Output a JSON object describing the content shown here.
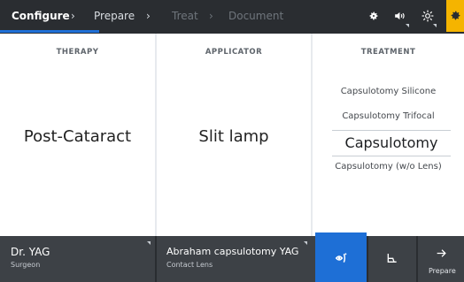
{
  "workflow": {
    "steps": [
      {
        "label": "Configure",
        "state": "active"
      },
      {
        "label": "Prepare",
        "state": "enabled"
      },
      {
        "label": "Treat",
        "state": "disabled"
      },
      {
        "label": "Document",
        "state": "disabled"
      }
    ]
  },
  "toolbar": {
    "icons": [
      "gear-icon",
      "speaker-icon",
      "brightness-icon",
      "settings-icon"
    ],
    "accent_color": "#f5b400"
  },
  "therapy": {
    "heading": "THERAPY",
    "value": "Post-Cataract"
  },
  "applicator": {
    "heading": "APPLICATOR",
    "value": "Slit lamp"
  },
  "treatment": {
    "heading": "TREATMENT",
    "options": [
      "Capsulotomy Silicone",
      "Capsulotomy Trifocal",
      "Capsulotomy",
      "Capsulotomy (w/o Lens)"
    ],
    "selected": "Capsulotomy"
  },
  "bottom": {
    "surgeon_name": "Dr. YAG",
    "surgeon_role": "Surgeon",
    "procedure_name": "Abraham capsulotomy YAG",
    "procedure_lens": "Contact Lens",
    "next_label": "Prepare",
    "active_color": "#1e6fd6"
  }
}
